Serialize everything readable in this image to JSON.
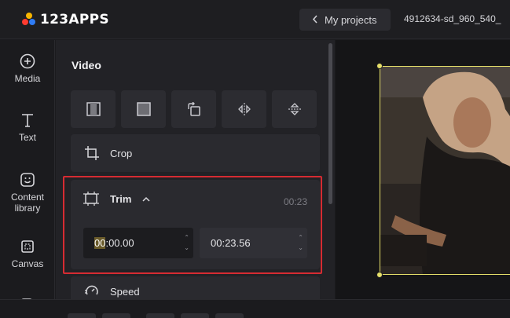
{
  "app": {
    "logo_text": "123APPS",
    "brand_colors": [
      "#f7b500",
      "#ff3b30",
      "#2f7cf6",
      "#30c04f"
    ]
  },
  "header": {
    "back_label": "My projects",
    "filename": "4912634-sd_960_540_"
  },
  "sidebar": {
    "items": [
      {
        "label": "Media",
        "icon": "add-circle-icon"
      },
      {
        "label": "Text",
        "icon": "text-icon"
      },
      {
        "label": "Content library",
        "icon": "sticker-icon"
      },
      {
        "label": "Canvas",
        "icon": "canvas-icon"
      },
      {
        "label": "",
        "icon": "record-icon"
      }
    ]
  },
  "panel": {
    "title": "Video",
    "tools": [
      "flip-frame-icon",
      "crop-square-icon",
      "rotate-icon",
      "flip-horizontal-icon",
      "flip-vertical-icon"
    ],
    "crop_label": "Crop",
    "trim": {
      "label": "Trim",
      "duration": "00:23",
      "start_highlight": "00",
      "start_rest": ":00.00",
      "end": "00:23.56"
    },
    "speed_label": "Speed"
  },
  "colors": {
    "highlight_border": "#d62b32",
    "selection_frame": "#e6e06a"
  }
}
